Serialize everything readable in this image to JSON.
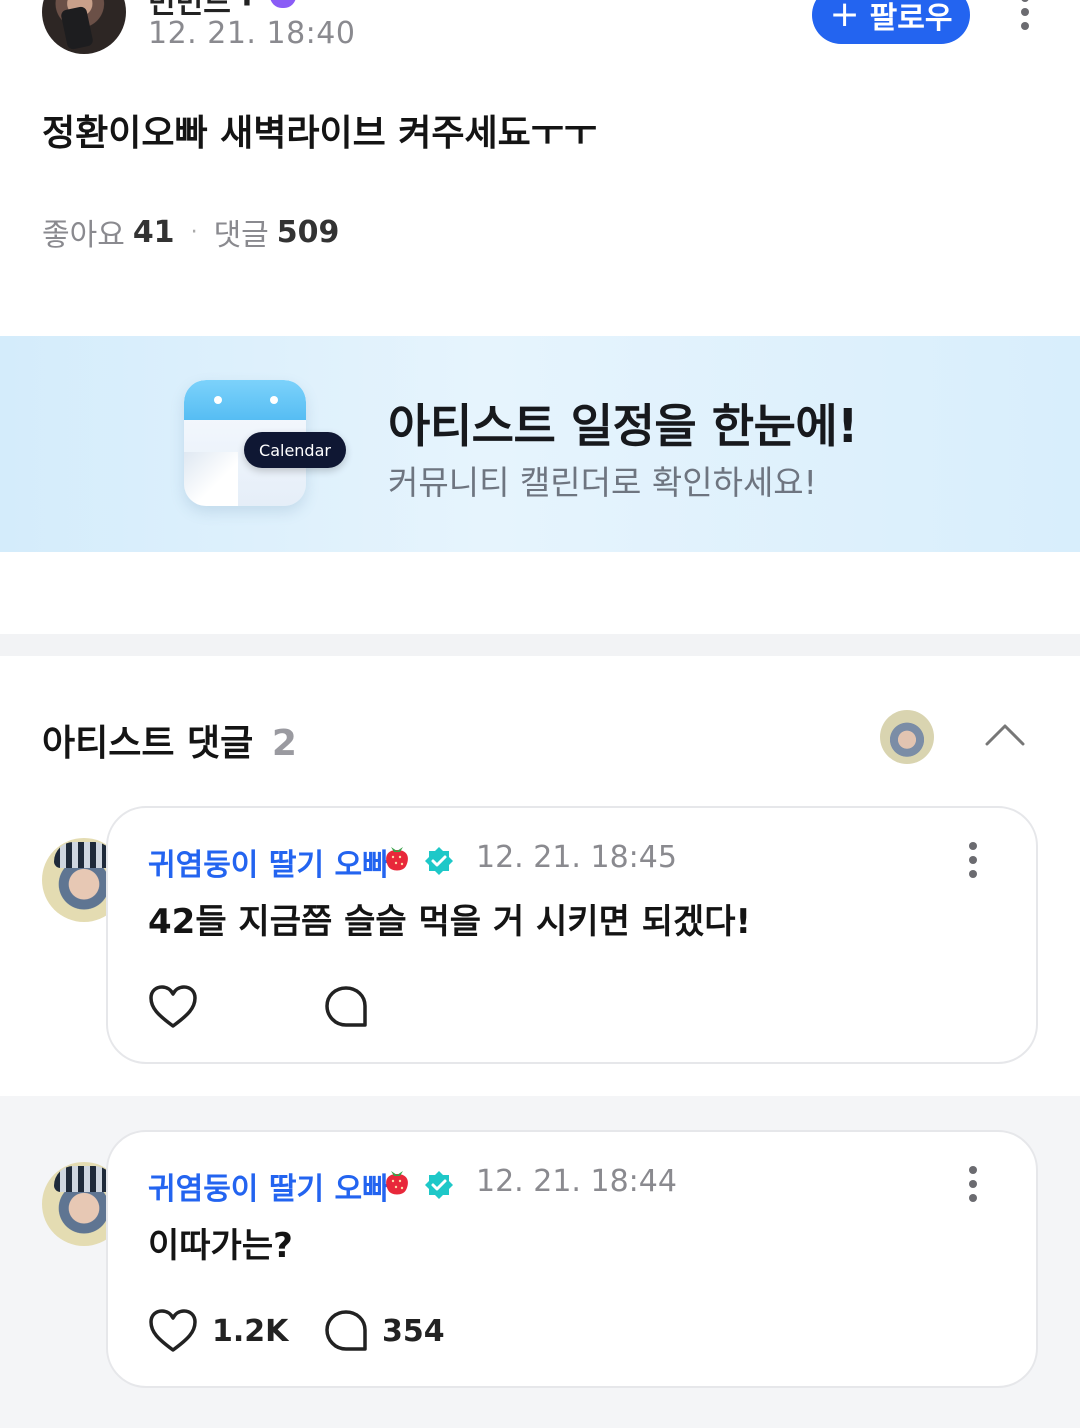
{
  "post": {
    "author_name": "민민드 ·",
    "time": "12. 21. 18:40",
    "follow_label": "팔로우",
    "text": "정환이오빠 새벽라이브 켜주세됴ㅜㅜ",
    "likes_label": "좋아요",
    "likes_count": "41",
    "comments_label": "댓글",
    "comments_count": "509"
  },
  "banner": {
    "calendar_label": "Calendar",
    "title": "아티스트 일정을 한눈에!",
    "subtitle": "커뮤니티 캘린더로 확인하세요!"
  },
  "artist_comments": {
    "title": "아티스트 댓글",
    "count": "2",
    "items": [
      {
        "name": "귀염둥이 딸기 오빠",
        "time": "12. 21. 18:45",
        "text": "42들 지금쯤 슬슬 먹을 거 시키면 되겠다!",
        "likes": "",
        "replies": ""
      },
      {
        "name": "귀염둥이 딸기 오빠",
        "time": "12. 21. 18:44",
        "text": "이따가는?",
        "likes": "1.2K",
        "replies": "354"
      }
    ]
  },
  "colors": {
    "accent": "#2364f0",
    "verified": "#1ec8c8",
    "strawberry": "#e8283a"
  },
  "icons": [
    "plus-icon",
    "more-icon",
    "calendar-icon",
    "chevron-up-icon",
    "strawberry-icon",
    "verified-icon",
    "heart-icon",
    "comment-icon"
  ]
}
